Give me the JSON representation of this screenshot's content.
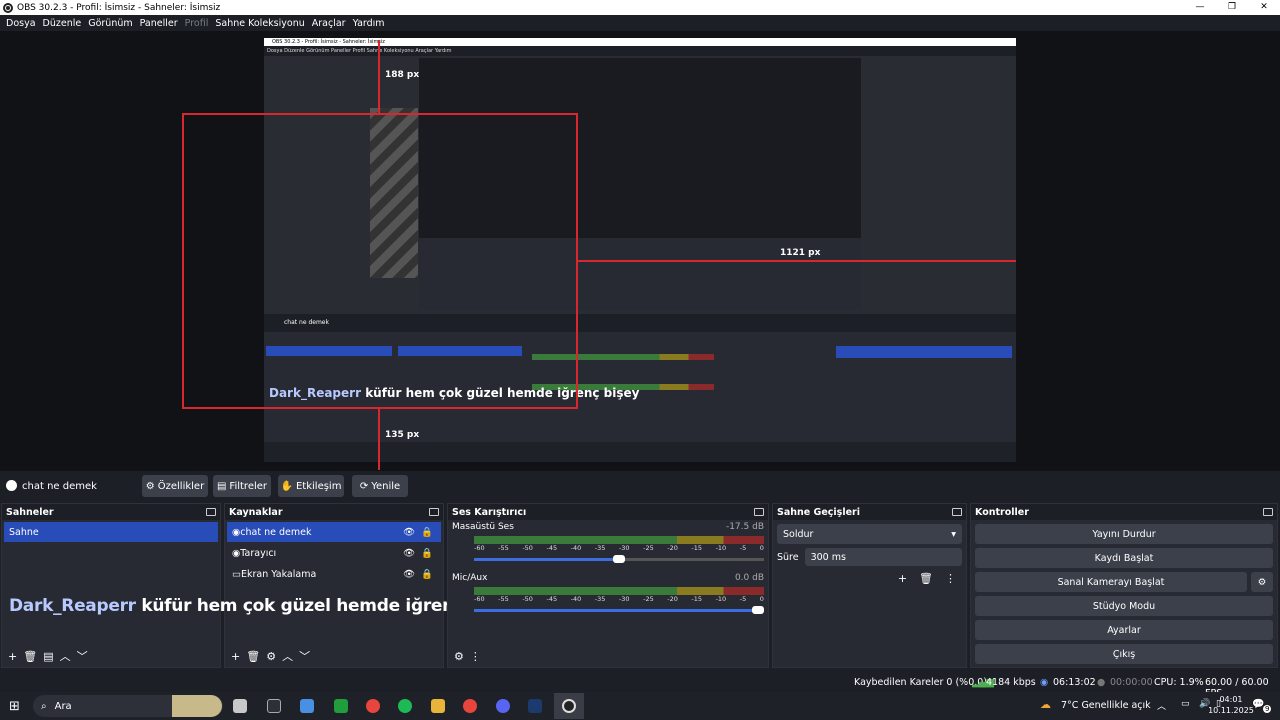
{
  "window": {
    "title": "OBS 30.2.3 - Profil: İsimsiz - Sahneler: İsimsiz"
  },
  "menu": [
    "Dosya",
    "Düzenle",
    "Görünüm",
    "Paneller",
    "Profil",
    "Sahne Koleksiyonu",
    "Araçlar",
    "Yardım"
  ],
  "preview": {
    "measure_top": "188 px",
    "measure_bottom": "135 px",
    "measure_right": "1121 px",
    "inner_title": "OBS 30.2.3 - Profil: İsimsiz - Sahneler: İsimsiz",
    "inner_status": "Kaybedilen Kareler 0 (%0.0)    4184 kbps    06:13:02    00:00:00    CPU: 1.9%    60.00 / 60.00 FPS"
  },
  "source_bar": {
    "selected": "chat ne demek",
    "properties": "Özellikler",
    "filters": "Filtreler",
    "interact": "Etkileşim",
    "refresh": "Yenile"
  },
  "scenes": {
    "title": "Sahneler",
    "items": [
      "Sahne"
    ]
  },
  "sources": {
    "title": "Kaynaklar",
    "items": [
      "chat ne demek",
      "Tarayıcı",
      "Ekran Yakalama"
    ]
  },
  "chat_overlay": {
    "user": "Dark_Reaperr",
    "message": "küfür hem çok güzel hemde iğrenç bişey"
  },
  "mixer": {
    "title": "Ses Karıştırıcı",
    "channels": [
      {
        "name": "Masaüstü Ses",
        "db": "-17.5 dB",
        "volume": 0.52
      },
      {
        "name": "Mic/Aux",
        "db": "0.0 dB",
        "volume": 1.0
      }
    ],
    "scale": [
      "-60",
      "-55",
      "-50",
      "-45",
      "-40",
      "-35",
      "-30",
      "-25",
      "-20",
      "-15",
      "-10",
      "-5",
      "0"
    ]
  },
  "transitions": {
    "title": "Sahne Geçişleri",
    "selected": "Soldur",
    "duration_label": "Süre",
    "duration": "300 ms"
  },
  "controls": {
    "title": "Kontroller",
    "stop_stream": "Yayını Durdur",
    "start_record": "Kaydı Başlat",
    "virtual_cam": "Sanal Kamerayı Başlat",
    "studio": "Stüdyo Modu",
    "settings": "Ayarlar",
    "exit": "Çıkış"
  },
  "status": {
    "dropped": "Kaybedilen Kareler 0 (%0.0)",
    "bitrate": "4184 kbps",
    "live_time": "06:13:02",
    "rec_time": "00:00:00",
    "cpu": "CPU: 1.9%",
    "fps": "60.00 / 60.00 FPS"
  },
  "taskbar": {
    "search": "Ara",
    "weather": "7°C  Genellikle açık",
    "time": "04:01",
    "date": "10.11.2025",
    "notif_count": "9"
  },
  "colors": {
    "accent": "#284cb8",
    "danger": "#d8282e"
  }
}
